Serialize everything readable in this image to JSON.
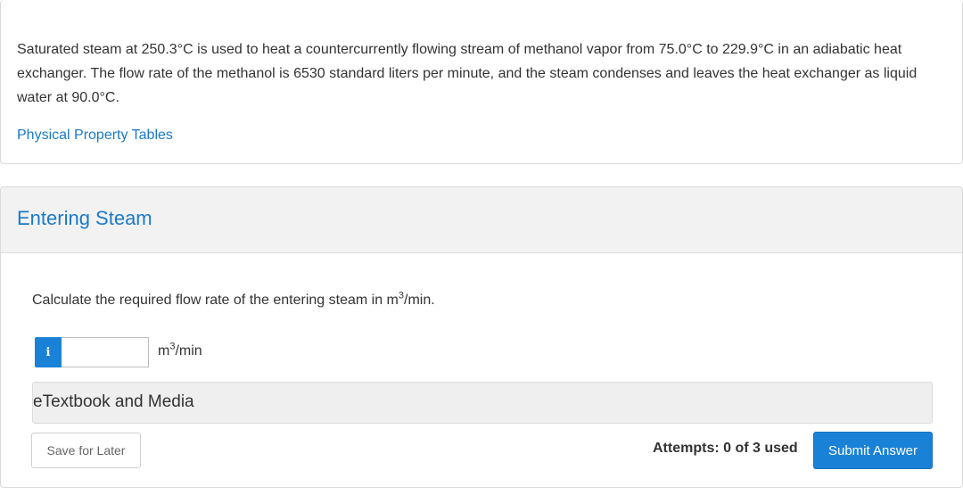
{
  "problem": {
    "text": "Saturated steam at 250.3°C is used to heat a countercurrently flowing stream of methanol vapor from 75.0°C to 229.9°C in an adiabatic heat exchanger. The flow rate of the methanol is 6530 standard liters per minute, and the steam condenses and leaves the heat exchanger as liquid water at 90.0°C.",
    "tables_link": "Physical Property Tables"
  },
  "part": {
    "title": "Entering Steam",
    "question_prefix": "Calculate the required flow rate of the entering steam in m",
    "question_sup": "3",
    "question_suffix": "/min.",
    "info_icon": "i",
    "answer_value": "",
    "unit_base": "m",
    "unit_sup": "3",
    "unit_suffix": "/min",
    "etextbook_label": "eTextbook and Media",
    "save_label": "Save for Later",
    "attempts": "Attempts: 0 of 3 used",
    "submit_label": "Submit Answer"
  },
  "colors": {
    "accent": "#1a82d6",
    "link": "#1a7ac9",
    "header_bg": "#f2f2f2"
  }
}
